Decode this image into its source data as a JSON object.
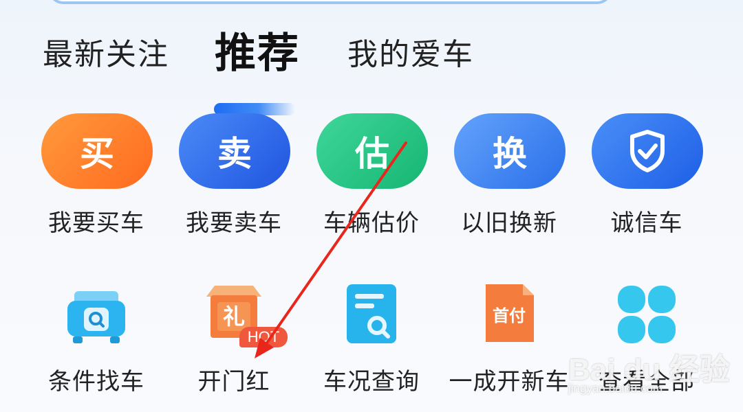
{
  "tabs": [
    {
      "label": "最新关注"
    },
    {
      "label": "推荐"
    },
    {
      "label": "我的爱车"
    }
  ],
  "top_services": [
    {
      "glyph": "买",
      "label": "我要买车",
      "color": "#ff7e2b"
    },
    {
      "glyph": "卖",
      "label": "我要卖车",
      "color": "#2f6ef2"
    },
    {
      "glyph": "估",
      "label": "车辆估价",
      "color": "#22c286"
    },
    {
      "glyph": "换",
      "label": "以旧换新",
      "color": "#3b86f2"
    },
    {
      "glyph": "",
      "label": "诚信车",
      "color": "#2c6ff0",
      "icon": "shield-check-icon"
    }
  ],
  "grid_services": [
    {
      "label": "条件找车",
      "icon": "car-search-icon"
    },
    {
      "label": "开门红",
      "icon": "gift-house-icon",
      "icon_text": "礼",
      "badge": "HOT"
    },
    {
      "label": "车况查询",
      "icon": "document-search-icon"
    },
    {
      "label": "一成开新车",
      "icon": "down-payment-icon",
      "icon_text": "首付"
    },
    {
      "label": "查看全部",
      "icon": "clover-grid-icon"
    }
  ],
  "watermark": {
    "text": "Bai du 经验",
    "url": "jingyan.baidu.com"
  },
  "colors": {
    "accent": "#1e6cf2",
    "annotation_arrow": "#e8261c"
  }
}
